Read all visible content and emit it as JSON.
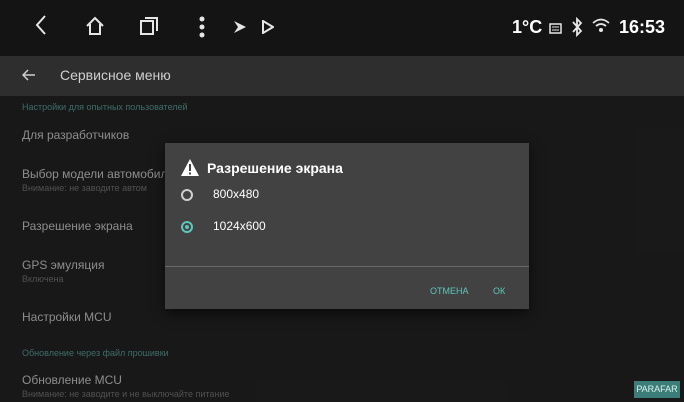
{
  "statusbar": {
    "temperature": "1°C",
    "time": "16:53"
  },
  "toolbar": {
    "title": "Сервисное меню"
  },
  "list": {
    "section_advanced": "Настройки для опытных пользователей",
    "developers": "Для разработчиков",
    "car_model_title": "Выбор модели автомобил",
    "car_model_sub": "Внимание: не заводите автом",
    "resolution": "Разрешение экрана",
    "gps_title": "GPS эмуляция",
    "gps_sub": "Включена",
    "mcu_settings": "Настройки MCU",
    "section_update": "Обновление через файл прошивки",
    "mcu_update_title": "Обновление MCU",
    "mcu_update_sub": "Внимание: не заводите и не выключайте питание"
  },
  "dialog": {
    "title": "Разрешение экрана",
    "options": [
      {
        "label": "800x480",
        "selected": false
      },
      {
        "label": "1024x600",
        "selected": true
      }
    ],
    "cancel": "ОТМЕНА",
    "ok": "ОК"
  },
  "watermark": "PARAFAR",
  "colors": {
    "accent": "#5ec6bb",
    "dialog_bg": "#424242",
    "statusbar_bg": "#141414"
  }
}
